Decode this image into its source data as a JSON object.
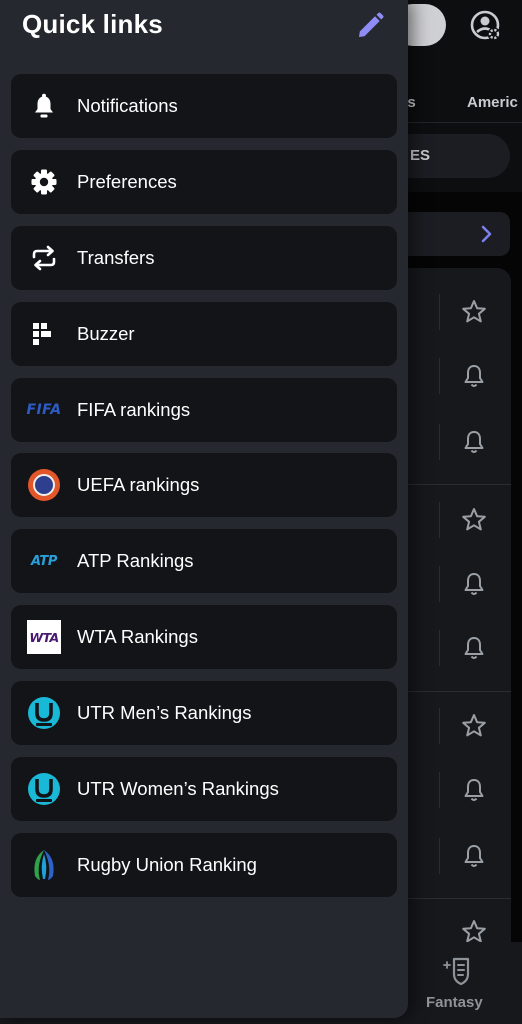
{
  "drawer": {
    "title": "Quick links",
    "edit_icon": "pencil-icon",
    "items": [
      {
        "label": "Notifications",
        "icon": "bell-icon"
      },
      {
        "label": "Preferences",
        "icon": "gear-icon"
      },
      {
        "label": "Transfers",
        "icon": "transfer-arrows-icon"
      },
      {
        "label": "Buzzer",
        "icon": "buzzer-icon"
      },
      {
        "label": "FIFA rankings",
        "icon": "fifa-logo",
        "logo_text": "FIFA"
      },
      {
        "label": "UEFA rankings",
        "icon": "uefa-logo"
      },
      {
        "label": "ATP Rankings",
        "icon": "atp-logo",
        "logo_text": "ATP"
      },
      {
        "label": "WTA Rankings",
        "icon": "wta-logo",
        "logo_text": "WTA"
      },
      {
        "label": "UTR Men’s Rankings",
        "icon": "utr-logo"
      },
      {
        "label": "UTR Women’s Rankings",
        "icon": "utr-logo"
      },
      {
        "label": "Rugby Union Ranking",
        "icon": "world-rugby-logo"
      }
    ]
  },
  "background": {
    "tabs": [
      "nis",
      "Americ"
    ],
    "chip_text": "ES",
    "bottom_nav": {
      "fantasy_label": "Fantasy"
    }
  },
  "colors": {
    "drawer_bg": "#25282e",
    "item_bg": "#121417",
    "accent_edit": "#8f8cf5",
    "fifa_blue": "#2d5cc6",
    "atp_blue": "#2aa0d8",
    "utr_cyan": "#19b8d6",
    "wta_purple": "#4a1a72"
  }
}
